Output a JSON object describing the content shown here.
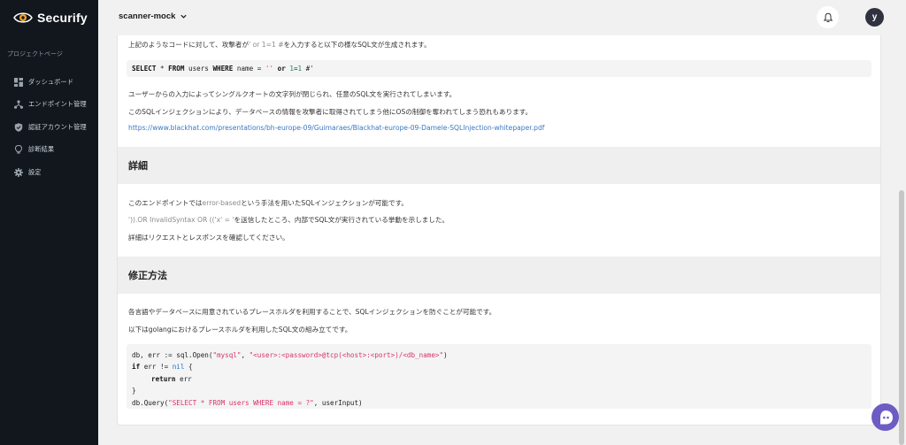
{
  "brand": {
    "name": "Securify",
    "logo_icon": "eye-logo-icon",
    "accent": "#f5a623"
  },
  "sidebar": {
    "section_label": "プロジェクトページ",
    "items": [
      {
        "label": "ダッシュボード",
        "icon": "dashboard-icon"
      },
      {
        "label": "エンドポイント管理",
        "icon": "endpoint-icon"
      },
      {
        "label": "認証アカウント管理",
        "icon": "shield-icon"
      },
      {
        "label": "診断結果",
        "icon": "lightbulb-icon"
      },
      {
        "label": "設定",
        "icon": "gear-icon"
      }
    ]
  },
  "header": {
    "project_name": "scanner-mock",
    "avatar_initial": "y"
  },
  "content": {
    "intro_a": "上記のようなコードに対して、攻撃者が",
    "intro_payload": "' or 1=1 #",
    "intro_b": "を入力すると以下の様なSQL文が生成されます。",
    "sql_kw1": "SELECT",
    "sql_star": " * ",
    "sql_kw2": "FROM",
    "sql_mid": " users ",
    "sql_kw3": "WHERE",
    "sql_cond": " name = ",
    "sql_str": "''",
    "sql_or": " or ",
    "sql_n1": "1",
    "sql_eq": "=",
    "sql_n2": "1",
    "sql_tail": " #'",
    "para1": "ユーザーからの入力によってシングルクオートの文字列が閉じられ、任意のSQL文を実行されてしまいます。",
    "para2": "このSQLインジェクションにより、データベースの情報を攻撃者に取得されてしまう他にOSの制御を奪われてしまう恐れもあります。",
    "ref_link": "https://www.blackhat.com/presentations/bh-europe-09/Guimaraes/Blackhat-europe-09-Damele-SQLInjection-whitepaper.pdf",
    "detail_heading": "詳細",
    "detail1_a": "このエンドポイントでは",
    "detail1_method": "error-based",
    "detail1_b": "という手法を用いたSQLインジェクションが可能です。",
    "detail2_payload": "')).OR InvalidSyntax OR (('x' = '",
    "detail2_b": "を送信したところ、内部でSQL文が実行されている挙動を示しました。",
    "detail3": "詳細はリクエストとレスポンスを確認してください。",
    "fix_heading": "修正方法",
    "fix1": "各言語やデータベースに用意されているプレースホルダを利用することで、SQLインジェクションを防ぐことが可能です。",
    "fix2": "以下はgolangにおけるプレースホルダを利用したSQL文の組み立てです。",
    "code_l1_a": "db, err := sql.Open(",
    "code_l1_s1": "\"mysql\"",
    "code_l1_c": ", ",
    "code_l1_s2": "\"<user>:<password>@tcp(<host>:<port>)/<db_name>\"",
    "code_l1_e": ")",
    "code_l2_kw": "if",
    "code_l2_a": " err != ",
    "code_l2_nil": "nil",
    "code_l2_b": " {",
    "code_l3_kw": "return",
    "code_l3_a": " err",
    "code_l4": "}",
    "code_l5_a": "db.Query(",
    "code_l5_s": "\"SELECT * FROM users WHERE name = ?\"",
    "code_l5_b": ", userInput)"
  },
  "colors": {
    "sidebar_bg": "#11171d",
    "link": "#3a78c5",
    "chat_bubble": "#6c5cc4",
    "string": "#d6336c"
  }
}
